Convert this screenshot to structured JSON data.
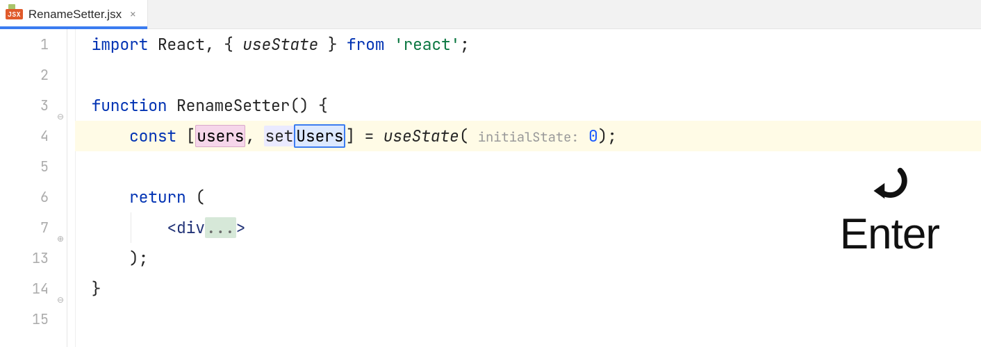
{
  "tab": {
    "badge": "JSX",
    "filename": "RenameSetter.jsx",
    "close": "✕"
  },
  "gutter": [
    "1",
    "2",
    "3",
    "4",
    "5",
    "6",
    "7",
    "13",
    "14",
    "15"
  ],
  "code": {
    "l1": {
      "import": "import",
      "react": "React",
      "c": ",",
      "ob": "{",
      "useState": "useState",
      "cb": "}",
      "from": "from",
      "q1": "'",
      "pkg": "react",
      "q2": "'",
      "sc": ";"
    },
    "l3": {
      "fn": "function",
      "name": "RenameSetter",
      "op": "()",
      "ob": "{"
    },
    "l4": {
      "const": "const",
      "ob": "[",
      "var": "users",
      "c": ",",
      "set_prefix": "set",
      "set_suffix": "Users",
      "cb": "]",
      "eq": "=",
      "useState": "useState",
      "op": "(",
      "hint": "initialState:",
      "zero": "0",
      "cp": ")",
      "sc": ";"
    },
    "l6": {
      "ret": "return",
      "op": "("
    },
    "l7": {
      "lt": "<",
      "tag": "div",
      "dots": "...",
      "gt": ">"
    },
    "l13": {
      "cp": ")",
      "sc": ";"
    },
    "l14": {
      "cb": "}"
    }
  },
  "overlay": {
    "label": "Enter"
  }
}
